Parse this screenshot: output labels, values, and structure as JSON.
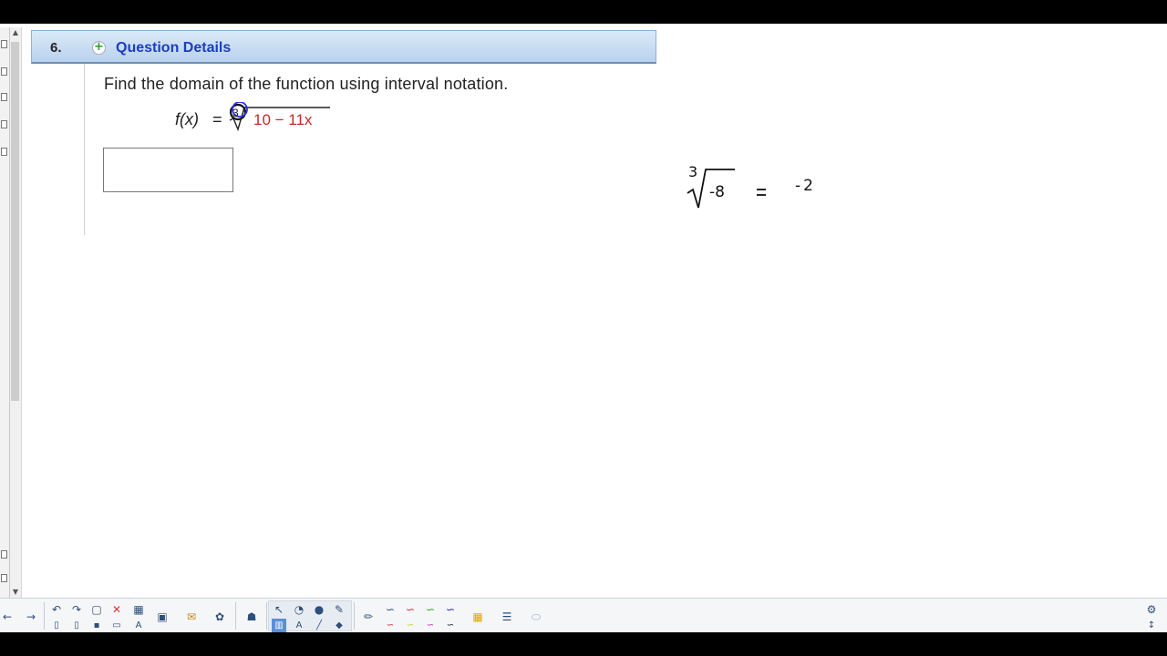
{
  "question": {
    "number": "6.",
    "expand_symbol": "+",
    "title": "Question Details",
    "prompt": "Find the domain of the function using interval notation.",
    "function_lhs": "f(x)",
    "equals": "=",
    "radicand": "10 − 11x",
    "radical_index": "3",
    "answer_value": ""
  },
  "annotation": {
    "index": "3",
    "radicand": "-8",
    "equals": "=",
    "result": "-2"
  },
  "toolbar": {
    "icons": [
      "back-arrow",
      "forward-arrow",
      "undo",
      "redo",
      "page",
      "delete",
      "table",
      "screen",
      "folder",
      "capture",
      "hand",
      "select",
      "shape",
      "fill",
      "pen",
      "text",
      "eraser",
      "marker",
      "line-black",
      "line-red",
      "line-green",
      "line-blue",
      "grid",
      "more",
      "settings"
    ]
  },
  "colors": {
    "header_title": "#1a3fbf",
    "radicand": "#c8282a",
    "header_bg": "#c6dbf2"
  }
}
